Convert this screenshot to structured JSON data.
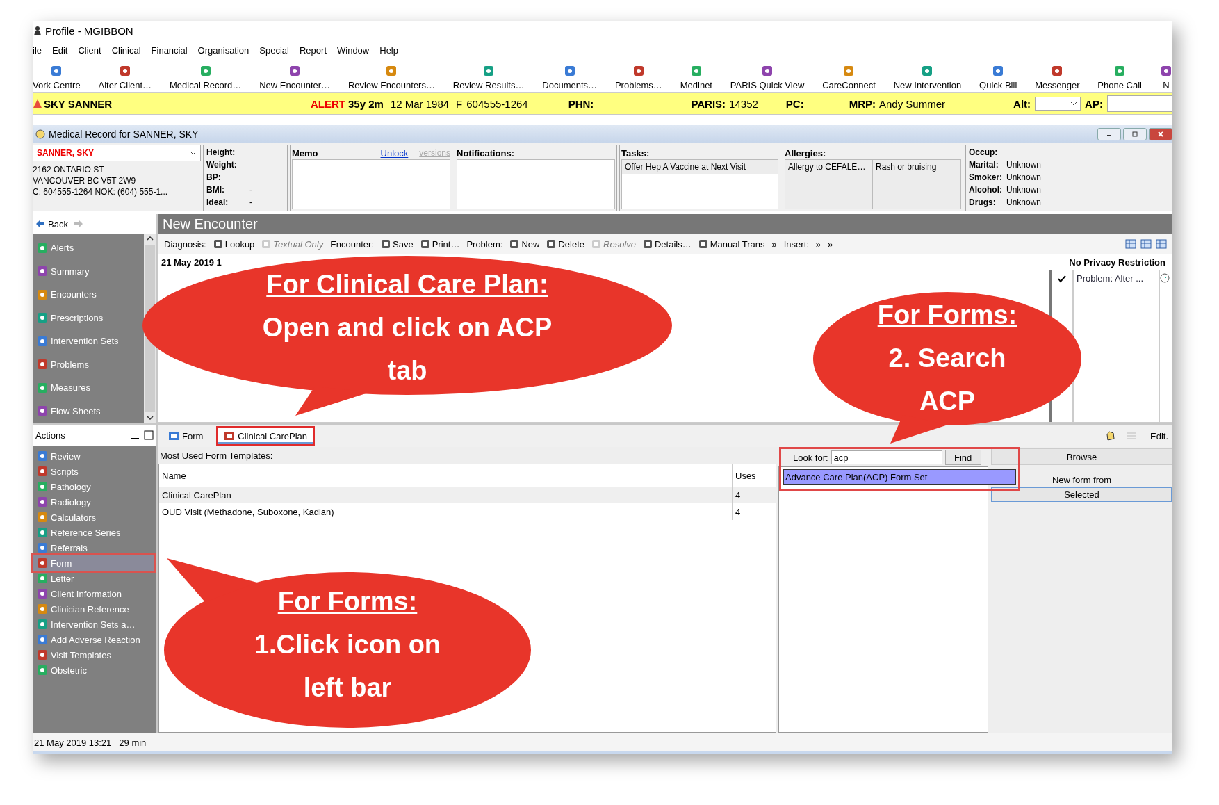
{
  "window": {
    "title": "Profile - MGIBBON"
  },
  "menu": [
    "ile",
    "Edit",
    "Client",
    "Clinical",
    "Financial",
    "Organisation",
    "Special",
    "Report",
    "Window",
    "Help"
  ],
  "toolbar": [
    "Vork Centre",
    "Alter Client…",
    "Medical Record…",
    "New Encounter…",
    "Review Encounters…",
    "Review Results…",
    "Documents…",
    "Problems…",
    "Medinet",
    "PARIS Quick View",
    "CareConnect",
    "New Intervention",
    "Quick Bill",
    "Messenger",
    "Phone Call",
    "N"
  ],
  "patient_bar": {
    "name": "SKY SANNER",
    "alert": "ALERT",
    "age": "35y 2m",
    "dob": "12 Mar 1984",
    "sex": "F",
    "number": "604555-1264",
    "phn_label": "PHN:",
    "paris_label": "PARIS:",
    "paris": "14352",
    "pc_label": "PC:",
    "mrp_label": "MRP:",
    "mrp": "Andy Summer",
    "alt_label": "Alt:",
    "ap_label": "AP:"
  },
  "medical_record": {
    "title": "Medical Record for SANNER, SKY",
    "patient": "SANNER, SKY",
    "address": [
      "2162 ONTARIO ST",
      "VANCOUVER  BC  V5T 2W9",
      "C: 604555-1264 NOK: (604) 555-1..."
    ],
    "vitals": [
      {
        "label": "Height:"
      },
      {
        "label": "Weight:"
      },
      {
        "label": "BP:"
      },
      {
        "label": "BMI:",
        "value": "-"
      },
      {
        "label": "Ideal:",
        "value": "-"
      }
    ],
    "memo": {
      "label": "Memo",
      "link": "Unlock",
      "versions": "versions"
    },
    "notifications": "Notifications:",
    "tasks": {
      "label": "Tasks:",
      "items": [
        "Offer Hep A Vaccine at Next Visit"
      ]
    },
    "allergies": {
      "label": "Allergies:",
      "items": [
        "Allergy to CEFALE…",
        "Rash or bruising"
      ]
    },
    "social": [
      {
        "label": "Occup:"
      },
      {
        "label": "Marital:",
        "value": "Unknown"
      },
      {
        "label": "Smoker:",
        "value": "Unknown"
      },
      {
        "label": "Alcohol:",
        "value": "Unknown"
      },
      {
        "label": "Drugs:",
        "value": "Unknown"
      }
    ]
  },
  "navigation": {
    "back": "Back",
    "items": [
      "Alerts",
      "Summary",
      "Encounters",
      "Prescriptions",
      "Intervention Sets",
      "Problems",
      "Measures",
      "Flow Sheets"
    ]
  },
  "actions": {
    "title": "Actions",
    "items": [
      {
        "label": "Review",
        "highlighted": false
      },
      {
        "label": "Scripts",
        "highlighted": false
      },
      {
        "label": "Pathology",
        "highlighted": false
      },
      {
        "label": "Radiology",
        "highlighted": false
      },
      {
        "label": "Calculators",
        "highlighted": false
      },
      {
        "label": "Reference Series",
        "highlighted": false
      },
      {
        "label": "Referrals",
        "highlighted": false
      },
      {
        "label": "Form",
        "highlighted": true
      },
      {
        "label": "Letter",
        "highlighted": false
      },
      {
        "label": "Client Information",
        "highlighted": false
      },
      {
        "label": "Clinician Reference",
        "highlighted": false
      },
      {
        "label": "Intervention Sets a…",
        "highlighted": false
      },
      {
        "label": "Add Adverse Reaction",
        "highlighted": false
      },
      {
        "label": "Visit Templates",
        "highlighted": false
      },
      {
        "label": "Obstetric",
        "highlighted": false
      }
    ]
  },
  "encounter": {
    "title": "New Encounter",
    "toolbar": [
      {
        "kind": "label",
        "label": "Diagnosis:"
      },
      {
        "kind": "button",
        "label": "Lookup",
        "disabled": false
      },
      {
        "kind": "button",
        "label": "Textual Only",
        "disabled": true
      },
      {
        "kind": "label",
        "label": "Encounter:"
      },
      {
        "kind": "button",
        "label": "Save",
        "disabled": false
      },
      {
        "kind": "button",
        "label": "Print…",
        "disabled": false
      },
      {
        "kind": "label",
        "label": "Problem:"
      },
      {
        "kind": "button",
        "label": "New",
        "disabled": false
      },
      {
        "kind": "button",
        "label": "Delete",
        "disabled": false
      },
      {
        "kind": "button",
        "label": "Resolve",
        "disabled": true
      },
      {
        "kind": "button",
        "label": "Details…",
        "disabled": false
      },
      {
        "kind": "button",
        "label": "Manual Trans",
        "disabled": false
      },
      {
        "kind": "label",
        "label": "»"
      },
      {
        "kind": "label",
        "label": "Insert:"
      },
      {
        "kind": "label",
        "label": "»"
      },
      {
        "kind": "label",
        "label": "»"
      }
    ],
    "date": "21 May 2019 1",
    "privacy": "No Privacy Restriction",
    "problem_column": "Problem: Alter ..."
  },
  "forms": {
    "tabs": [
      {
        "label": "Form",
        "selected": false,
        "highlighted": false
      },
      {
        "label": "Clinical CarePlan",
        "selected": true,
        "highlighted": true
      }
    ],
    "edit": "Edit.",
    "heading": "Most Used Form Templates:",
    "columns": [
      "Name",
      "Uses"
    ],
    "rows": [
      {
        "name": "Clinical CarePlan",
        "uses": "4",
        "selected": true
      },
      {
        "name": "OUD Visit (Methadone, Suboxone, Kadian)",
        "uses": "4",
        "selected": false
      }
    ],
    "search": {
      "label": "Look for:",
      "value": "acp",
      "button": "Find",
      "highlighted": true,
      "results": [
        {
          "label": "Advance Care Plan(ACP) Form Set",
          "selected": true
        }
      ]
    },
    "browse": "Browse",
    "new_from": "New form from",
    "selected_button": "Selected"
  },
  "status_bar": [
    "21 May 2019 13:21",
    "29 min"
  ],
  "callouts": [
    {
      "heading": "For Clinical Care Plan:",
      "lines": [
        "Open and click on ACP",
        "tab"
      ]
    },
    {
      "heading": "For Forms:",
      "lines": [
        "2. Search",
        "ACP"
      ]
    },
    {
      "heading": "For Forms:",
      "lines": [
        "1.Click icon on",
        "left bar"
      ]
    }
  ]
}
